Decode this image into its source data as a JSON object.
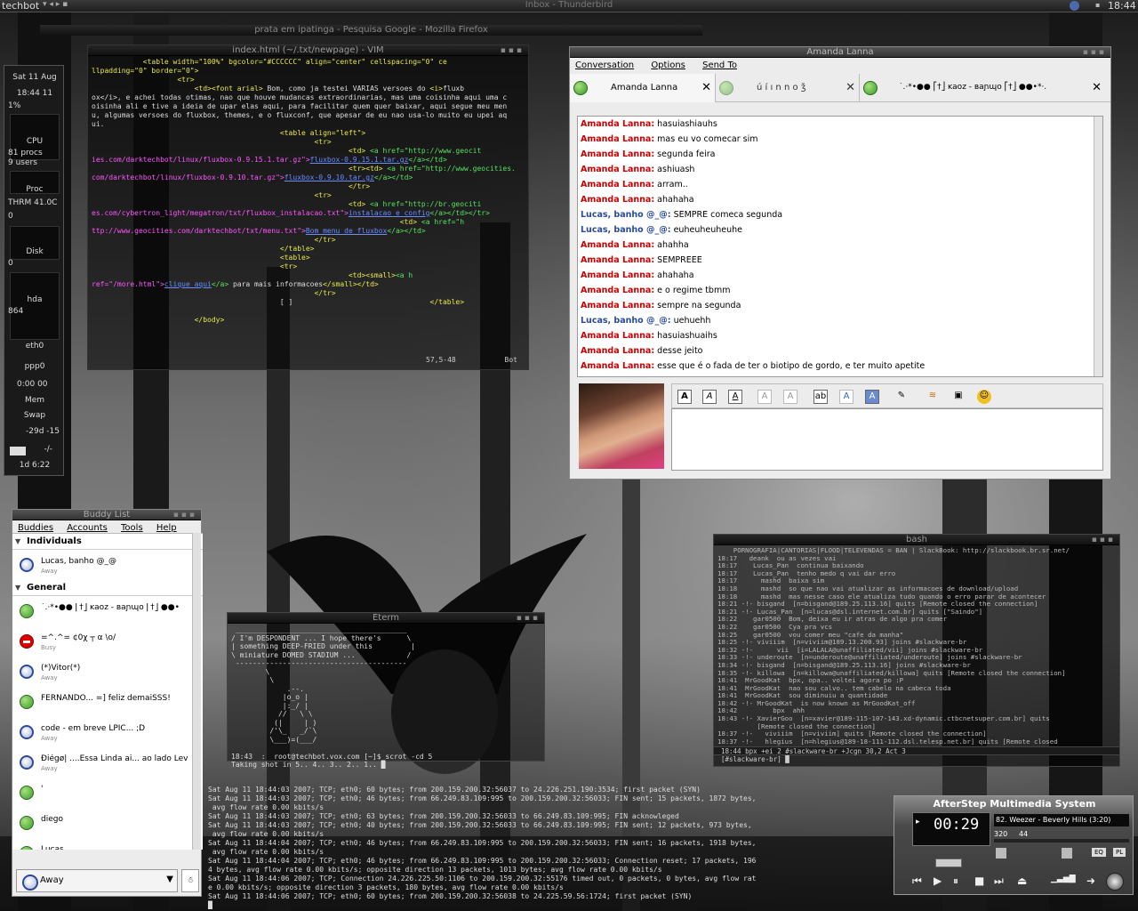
{
  "topbar": {
    "host": "techbot",
    "window_title": "Inbox - Thunderbird",
    "clock": "18:44"
  },
  "firefox_title": "prata em ipatinga - Pesquisa Google - Mozilla Firefox",
  "vim": {
    "title": "index.html (~/.txt/newpage) - VIM",
    "lines": [
      [
        [
          "t",
          "            <table width=\"100%\" bgcolor=\"#CCCCCC\" align=\"center\" cellspacing=\"0\" ce"
        ]
      ],
      [
        [
          "t",
          "llpadding=\"0\" border=\"0\">"
        ]
      ],
      [
        [
          "t",
          "                    <tr>"
        ]
      ],
      [
        [
          "t",
          "                        <td><font arial>"
        ],
        [
          "w",
          " Bom, como ja testei VARIAS versoes do "
        ],
        [
          "t",
          "<i>"
        ],
        [
          "w",
          "fluxb"
        ]
      ],
      [
        [
          "w",
          "ox</i>, e achei todas otimas, nao que houve mudancas extraordinarias, mas uma coisinha aqui uma c"
        ]
      ],
      [
        [
          "w",
          "oisinha ali e tive a ideia de upar elas aqui, para facilitar quem quer baixar, aqui segue meu men"
        ]
      ],
      [
        [
          "w",
          "u, algumas versoes do fluxbox, themes, e o fluxconf, que apesar de eu nao usa-lo muito eu upei aq"
        ]
      ],
      [
        [
          "w",
          "ui."
        ]
      ],
      [
        [
          "t",
          "                                            <table align=\"left\">"
        ]
      ],
      [
        [
          "t",
          "                                                    <tr>"
        ]
      ],
      [
        [
          "t",
          "                                                            <td> "
        ],
        [
          "a",
          "<a href=\"http://www.geocit"
        ]
      ],
      [
        [
          "s",
          "ies.com/darktechbot/linux/fluxbox-0.9.15.1.tar.gz\">"
        ],
        [
          "l",
          "fluxbox-0.9.15.1.tar.gz"
        ],
        [
          "a",
          "</a></td>"
        ]
      ],
      [
        [
          "t",
          "                                                            <tr><td> "
        ],
        [
          "a",
          "<a href=\"http://www.geocities."
        ]
      ],
      [
        [
          "s",
          "com/darktechbot/linux/fluxbox-0.9.10.tar.gz\">"
        ],
        [
          "l",
          "fluxbox-0.9.10.tar.gz"
        ],
        [
          "a",
          "</a></td>"
        ]
      ],
      [
        [
          "t",
          "                                                            </tr>"
        ]
      ],
      [
        [
          "t",
          "                                                    <tr>"
        ]
      ],
      [
        [
          "t",
          "                                                            <td> "
        ],
        [
          "a",
          "<a href=\"http://br.geociti"
        ]
      ],
      [
        [
          "s",
          "es.com/cybertron_light/megatron/txt/fluxbox_instalacao.txt\">"
        ],
        [
          "l",
          "instalacao e config"
        ],
        [
          "a",
          "</a></td></tr>"
        ]
      ],
      [
        [
          "t",
          "                                                                        <td> "
        ],
        [
          "a",
          "<a href=\"h"
        ]
      ],
      [
        [
          "s",
          "ttp://www.geocities.com/darktechbot/txt/menu.txt\">"
        ],
        [
          "l",
          "Bom menu de fluxbox"
        ],
        [
          "a",
          "</a></td>"
        ]
      ],
      [
        [
          "t",
          "                                                    </tr>"
        ]
      ],
      [
        [
          "t",
          "                                            </table>"
        ]
      ],
      [
        [
          "t",
          "                                            <table>"
        ]
      ],
      [
        [
          "t",
          "                                            <tr>"
        ]
      ],
      [
        [
          "t",
          "                                                            <td><small>"
        ],
        [
          "a",
          "<a h"
        ]
      ],
      [
        [
          "s",
          "ref=\"/more.html\">"
        ],
        [
          "l",
          "clique aqui"
        ],
        [
          "a",
          "</a>"
        ],
        [
          "w",
          " para mais informacoes"
        ],
        [
          "t",
          "</small></td>"
        ]
      ],
      [
        [
          "t",
          "                                                    </tr>"
        ]
      ],
      [
        [
          "w",
          "                                            [ ]"
        ],
        [
          "t",
          "                                </table>"
        ]
      ],
      [
        [
          "w",
          ""
        ]
      ],
      [
        [
          "t",
          "                        </body>"
        ]
      ]
    ],
    "position": "57,5-48",
    "scroll": "Bot"
  },
  "gkrellm": {
    "date": "Sat 11 Aug",
    "time": "18:44 11",
    "cpu_pct": "1%",
    "cpu_label": "CPU",
    "procs": "81  procs",
    "users": "9  users",
    "proc_label": "Proc",
    "thrm": "THRM  41.0C",
    "thrm_val": "0",
    "disk_label": "Disk",
    "disk_val": "0",
    "hda_label": "hda",
    "hda_val": "864",
    "eth": "eth0",
    "ppp": "ppp0",
    "ppp_time": "0:00 00",
    "mem": "Mem",
    "swap": "Swap",
    "weather": "-29d -15",
    "mail": "-/-",
    "uptime": "1d  6:22"
  },
  "im": {
    "title": "Amanda Lanna",
    "menu": [
      "Conversation",
      "Options",
      "Send To"
    ],
    "tabs": [
      "Amanda Lanna",
      "ú í ı n n o ǯ",
      "˙.⋅*•●● ⎡†⎦ ĸaoz - ʙaɲɰo ⎡†⎦ ●●•*⋅."
    ],
    "messages": [
      {
        "who": "Amanda Lanna:",
        "text": "hasuiashiauhs",
        "side": "red"
      },
      {
        "who": "Amanda Lanna:",
        "text": "mas eu vo comecar sim",
        "side": "red"
      },
      {
        "who": "Amanda Lanna:",
        "text": "segunda feira",
        "side": "red"
      },
      {
        "who": "Amanda Lanna:",
        "text": "ashiuash",
        "side": "red"
      },
      {
        "who": "Amanda Lanna:",
        "text": "arram..",
        "side": "red"
      },
      {
        "who": "Amanda Lanna:",
        "text": "ahahaha",
        "side": "red"
      },
      {
        "who": "Lucas, banho @_@:",
        "text": "SEMPRE comeca segunda",
        "side": "blue"
      },
      {
        "who": "Lucas, banho @_@:",
        "text": "euheuheuheuhe",
        "side": "blue"
      },
      {
        "who": "Amanda Lanna:",
        "text": "ahahha",
        "side": "red"
      },
      {
        "who": "Amanda Lanna:",
        "text": "SEMPREEE",
        "side": "red"
      },
      {
        "who": "Amanda Lanna:",
        "text": "ahahaha",
        "side": "red"
      },
      {
        "who": "Amanda Lanna:",
        "text": "e o regime tbmm",
        "side": "red"
      },
      {
        "who": "Amanda Lanna:",
        "text": "sempre na segunda",
        "side": "red"
      },
      {
        "who": "Lucas, banho @_@:",
        "text": "uehuehh",
        "side": "blue"
      },
      {
        "who": "Amanda Lanna:",
        "text": "hasuiashuaihs",
        "side": "red"
      },
      {
        "who": "Amanda Lanna:",
        "text": "desse jeito",
        "side": "red"
      },
      {
        "who": "Amanda Lanna:",
        "text": "esse que é o fada de ter o biotipo de gordo, e ter muito apetite",
        "side": "red"
      }
    ]
  },
  "buddy": {
    "title": "Buddy List",
    "menu": [
      "Buddies",
      "Accounts",
      "Tools",
      "Help"
    ],
    "groups": [
      {
        "name": "Individuals",
        "items": [
          {
            "name": "Lucas, banho @_@",
            "status": "Away",
            "icon": "away"
          }
        ]
      },
      {
        "name": "General",
        "items": [
          {
            "name": "˙.⋅*•●● ⎡†⎦ ĸaoz - ʙaɲɰo ⎡†⎦ ●●•",
            "status": "",
            "icon": "avail"
          },
          {
            "name": "=^.^= ¢0χ  ┬  α  \\o/",
            "status": "Busy",
            "icon": "busy"
          },
          {
            "name": "(*)Vitor(*)",
            "status": "Away",
            "icon": "away"
          },
          {
            "name": "FERNANDO... =] feliz demaiSSS!",
            "status": "",
            "icon": "avail"
          },
          {
            "name": "code - em breve LPIC... ;D",
            "status": "Away",
            "icon": "away"
          },
          {
            "name": "Ðiégø| ....Essa Linda ai... ao lado Lev",
            "status": "Away",
            "icon": "away"
          },
          {
            "name": "'",
            "status": "",
            "icon": "avail"
          },
          {
            "name": "diego",
            "status": "",
            "icon": "avail"
          },
          {
            "name": "Lucas.",
            "status": "",
            "icon": "avail"
          }
        ]
      }
    ],
    "status": "Away"
  },
  "eterm": {
    "title": "Eterm",
    "text": " ________________________________________\n/ I'm DESPONDENT ... I hope there's      \\\n| something DEEP-FRIED under this         |\n\\ miniature DOMED STADIUM ...            /\n ----------------------------------------\n        \\\n         \\\n             .--.\n            |o_o |\n            |:_/ |\n           //   \\ \\\n          (|     | )\n         /'\\_   _/`\\\n         \\___)=(___/\n\n18:43  :  root@techbot.vox.com [~]$ scrot -cd 5\nTaking shot in 5.. 4.. 3.. 2.. 1.. █"
  },
  "irc": {
    "title": "bash",
    "text": "    PORNOGRAFIA|CANTORIAS|FLOOD|TELEVENDAS = BAN | SlackBook: http://slackbook.br.sr.net/\n18:17   deank  ou as vezes vai\n18:17    Lucas_Pan  continua baixando\n18:17    Lucas_Pan  tenho medo q vai dar erro\n18:17      mashd  baixa sim\n18:18      mashd  so que nao vai atualizar as informacoes de download/upload\n18:18      mashd  mas nesse caso ele atualiza tudo quando o erro parar de acontecer\n18:21 -!- bisgand  [n=bisgand@189.25.113.16] quits [Remote closed the connection]\n18:21 -!- Lucas_Pan  [n=lucas@dsl.internet.com.br] quits [\"Saindo\"]\n18:22    gar0500  Bom, deixa eu ir atras de algo pra comer\n18:22    gar0500  Cya pra vcs\n18:25    gar0500  vou comer meu \"cafe da manha\"\n18:25 -!- viviiim  [n=viviim@189.13.200.93] joins #slackware-br\n18:32 -!-      vii  [i=LALALA@unaffiliated/vii] joins #slackware-br\n18:33 -!- underoute  [n=underoute@unaffiliated/underoute] joins #slackware-br\n18:34 -!- bisgand  [n=bisgand@189.25.113.16] joins #slackware-br\n18:35 -!- killowa  [n=killowa@unaffiliated/killowa] quits [Remote closed the connection]\n18:41  MrGoodKat  bpx, opa.. voltei agora po :P\n18:41  MrGoodKat  nao sou calvo.. tem cabelo na cabeca toda\n18:41  MrGoodKat  sou diminuiu a quantidade\n18:42 -!- MrGoodKat  is now known as MrGoodKat_off\n18:42         bpx  ahh\n18:43 -!- XavierGoo  [n=xavier@189-115-107-143.xd-dynamic.ctbcnetsuper.com.br] quits\n          [Remote closed the connection]\n18:37 -!-   viviiim  [n=viviim] quits [Remote closed the connection]\n18:37 -!-   hlegius  [n=hlegius@189-18-111-112.dsl.telesp.net.br] quits [Remote closed",
    "status": "18:44  bpx +ei   2 #slackware-br +Jcgn 30,2   Act  3",
    "prompt": "[#slackware-br] █"
  },
  "log": "Sat Aug 11 18:44:03 2007; TCP; eth0; 60 bytes; from 200.159.200.32:56037 to 24.226.251.190:3534; first packet (SYN)\nSat Aug 11 18:44:03 2007; TCP; eth0; 46 bytes; from 66.249.83.109:995 to 200.159.200.32:56033; FIN sent; 15 packets, 1872 bytes,\n avg flow rate 0.00 kbits/s\nSat Aug 11 18:44:03 2007; TCP; eth0; 63 bytes; from 200.159.200.32:56033 to 66.249.83.109:995; FIN acknowleged\nSat Aug 11 18:44:03 2007; TCP; eth0; 40 bytes; from 200.159.200.32:56033 to 66.249.83.109:995; FIN sent; 12 packets, 973 bytes,\n avg flow rate 0.00 kbits/s\nSat Aug 11 18:44:04 2007; TCP; eth0; 46 bytes; from 66.249.83.109:995 to 200.159.200.32:56033; FIN sent; 16 packets, 1918 bytes,\n avg flow rate 0.00 kbits/s\nSat Aug 11 18:44:04 2007; TCP; eth0; 46 bytes; from 66.249.83.109:995 to 200.159.200.32:56033; Connection reset; 17 packets, 196\n4 bytes, avg flow rate 0.00 kbits/s; opposite direction 13 packets, 1013 bytes; avg flow rate 0.00 kbits/s\nSat Aug 11 18:44:06 2007; TCP; Connection 24.226.225.50:1106 to 200.159.200.32:55176 timed out, 0 packets, 0 bytes, avg flow rat\ne 0.00 kbits/s; opposite direction 3 packets, 180 bytes, avg flow rate 0.00 kbits/s\nSat Aug 11 18:44:06 2007; TCP; eth0; 60 bytes; from 200.159.200.32:56038 to 24.225.59.56:1724; first packet (SYN)\n█",
  "afterstep": {
    "title": "AfterStep Multimedia System",
    "time": "00:29",
    "song": "82. Weezer - Beverly Hills (3:20)",
    "bitrate": "320",
    "freq": "44"
  }
}
